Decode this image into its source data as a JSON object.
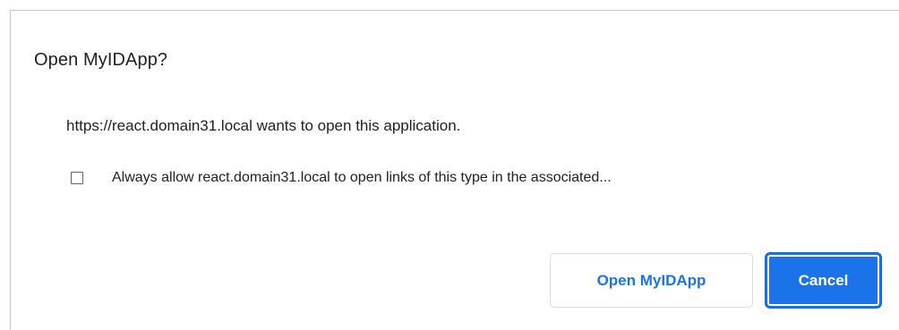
{
  "dialog": {
    "title": "Open MyIDApp?",
    "message": "https://react.domain31.local wants to open this application.",
    "checkbox": {
      "label": "Always allow react.domain31.local to open links of this type in the associated...",
      "checked": false
    },
    "buttons": {
      "open_label": "Open MyIDApp",
      "cancel_label": "Cancel"
    }
  },
  "colors": {
    "accent": "#1a73e8",
    "text": "#202124",
    "border": "#dadce0"
  }
}
